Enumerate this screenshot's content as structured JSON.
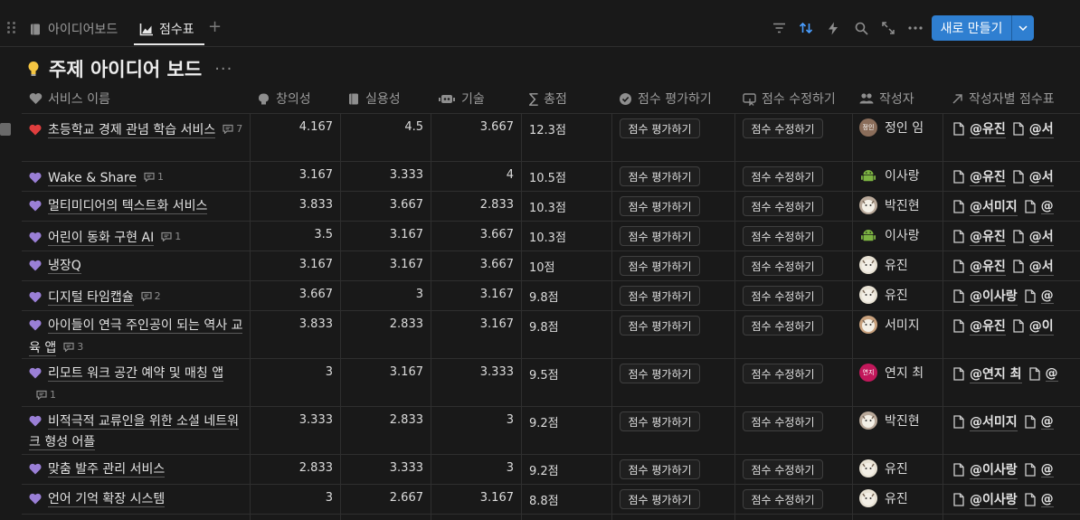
{
  "tabs": [
    {
      "label": "아이디어보드",
      "icon": "book-icon",
      "active": false
    },
    {
      "label": "점수표",
      "icon": "chart-icon",
      "active": true
    }
  ],
  "toolbar": {
    "new_label": "새로 만들기",
    "accent": "#2f7fd1",
    "sort_color": "#4a9eff"
  },
  "page": {
    "emoji": "lightbulb-icon",
    "title": "주제 아이디어 보드",
    "more": "···"
  },
  "columns": {
    "name": "서비스 이름",
    "creativity": "창의성",
    "practicality": "실용성",
    "tech": "기술",
    "total": "총점",
    "evaluate": "점수 평가하기",
    "edit": "점수 수정하기",
    "author": "작성자",
    "by_author": "작성자별 점수표"
  },
  "buttons": {
    "evaluate": "점수 평가하기",
    "edit": "점수 수정하기"
  },
  "rows": [
    {
      "name": "초등학교 경제 관념 학습 서비스",
      "heart": "#e03e3e",
      "comments": "7",
      "c": "4.167",
      "p": "4.5",
      "t": "3.667",
      "total": "12.3점",
      "author": "정인 임",
      "avatar_text": "정인",
      "avatar_color": "#8a6d5a",
      "refs": [
        "@유진",
        "@서"
      ]
    },
    {
      "name": "Wake & Share",
      "heart": "#9a7fd6",
      "comments": "1",
      "c": "3.167",
      "p": "3.333",
      "t": "4",
      "total": "10.5점",
      "author": "이사랑",
      "avatar_text": "",
      "avatar_color": "#7cb342",
      "refs": [
        "@유진",
        "@서"
      ]
    },
    {
      "name": "멀티미디어의 텍스트화 서비스",
      "heart": "#9a7fd6",
      "comments": "",
      "c": "3.833",
      "p": "3.667",
      "t": "2.833",
      "total": "10.3점",
      "author": "박진현",
      "avatar_text": "",
      "avatar_color": "#b9a99a",
      "refs": [
        "@서미지",
        "@"
      ]
    },
    {
      "name": "어린이 동화 구현 AI",
      "heart": "#9a7fd6",
      "comments": "1",
      "c": "3.5",
      "p": "3.167",
      "t": "3.667",
      "total": "10.3점",
      "author": "이사랑",
      "avatar_text": "",
      "avatar_color": "#7cb342",
      "refs": [
        "@유진",
        "@서"
      ]
    },
    {
      "name": "냉장Q",
      "heart": "#9a7fd6",
      "comments": "",
      "c": "3.167",
      "p": "3.167",
      "t": "3.667",
      "total": "10점",
      "author": "유진",
      "avatar_text": "",
      "avatar_color": "#e8e2d4",
      "refs": [
        "@유진",
        "@서"
      ]
    },
    {
      "name": "디지털 타임캡슐",
      "heart": "#9a7fd6",
      "comments": "2",
      "c": "3.667",
      "p": "3",
      "t": "3.167",
      "total": "9.8점",
      "author": "유진",
      "avatar_text": "",
      "avatar_color": "#e8e2d4",
      "refs": [
        "@이사랑",
        "@"
      ]
    },
    {
      "name": "아이들이 연극 주인공이 되는 역사 교육 앱",
      "heart": "#9a7fd6",
      "comments": "3",
      "c": "3.833",
      "p": "2.833",
      "t": "3.167",
      "total": "9.8점",
      "author": "서미지",
      "avatar_text": "",
      "avatar_color": "#c9a27e",
      "refs": [
        "@유진",
        "@이"
      ]
    },
    {
      "name": "리모트 워크 공간 예약 및 매칭 앱",
      "heart": "#9a7fd6",
      "comments": "1",
      "c": "3",
      "p": "3.167",
      "t": "3.333",
      "total": "9.5점",
      "author": "연지 최",
      "avatar_text": "연지",
      "avatar_color": "#c2185b",
      "refs": [
        "@연지 최",
        "@"
      ]
    },
    {
      "name": "비적극적 교류인을 위한 소셜 네트워크 형성 어플",
      "heart": "#9a7fd6",
      "comments": "",
      "c": "3.333",
      "p": "2.833",
      "t": "3",
      "total": "9.2점",
      "author": "박진현",
      "avatar_text": "",
      "avatar_color": "#b9a99a",
      "refs": [
        "@서미지",
        "@"
      ]
    },
    {
      "name": "맞춤 발주 관리 서비스",
      "heart": "#9a7fd6",
      "comments": "",
      "c": "2.833",
      "p": "3.333",
      "t": "3",
      "total": "9.2점",
      "author": "유진",
      "avatar_text": "",
      "avatar_color": "#e8e2d4",
      "refs": [
        "@이사랑",
        "@"
      ]
    },
    {
      "name": "언어 기억 확장 시스템",
      "heart": "#9a7fd6",
      "comments": "",
      "c": "3",
      "p": "2.667",
      "t": "3.167",
      "total": "8.8점",
      "author": "유진",
      "avatar_text": "",
      "avatar_color": "#e8e2d4",
      "refs": [
        "@이사랑",
        "@"
      ]
    }
  ]
}
